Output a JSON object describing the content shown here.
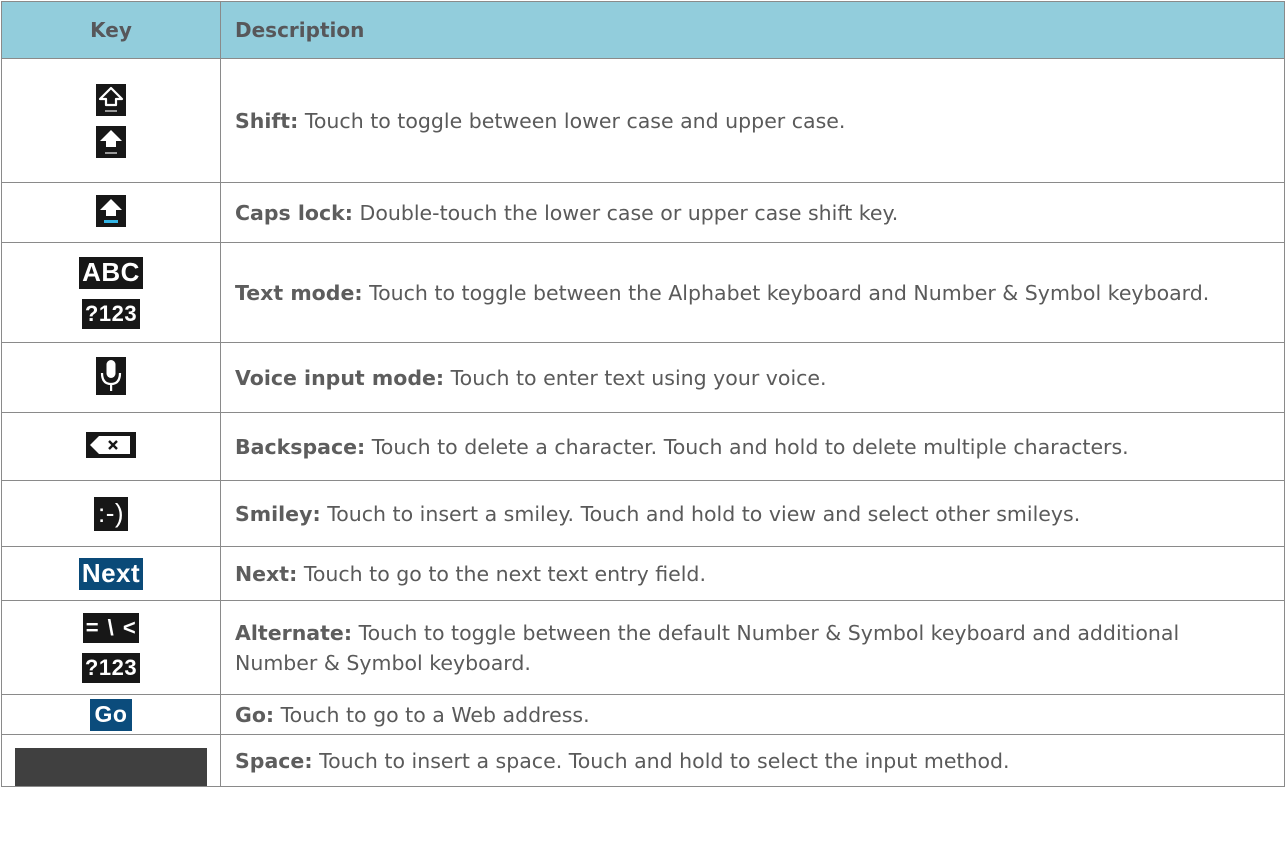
{
  "header": {
    "key": "Key",
    "description": "Description"
  },
  "rows": [
    {
      "name": "Shift:",
      "text": "Touch to toggle between lower case and upper case."
    },
    {
      "name": "Caps lock:",
      "text": "Double-touch the lower case or upper case shift key."
    },
    {
      "name": "Text mode:",
      "text": "Touch to toggle between the Alphabet keyboard and Number & Symbol keyboard."
    },
    {
      "name": "Voice input mode:",
      "text": "Touch to enter text using your voice."
    },
    {
      "name": "Backspace:",
      "text": "Touch to delete a character. Touch and hold to delete multiple characters."
    },
    {
      "name": "Smiley:",
      "text": "Touch to insert a smiley. Touch and hold to view and select other smileys."
    },
    {
      "name": "Next:",
      "text": "Touch to go to the next text entry field."
    },
    {
      "name": "Alternate:",
      "text": "Touch to toggle between the default Number & Symbol keyboard and additional Number & Symbol keyboard."
    },
    {
      "name": "Go:",
      "text": "Touch to go to a Web address."
    },
    {
      "name": "Space:",
      "text": "Touch to insert a space. Touch and hold to select the input method."
    }
  ],
  "key_labels": {
    "abc": "ABC",
    "num": "?123",
    "smiley": ":-)",
    "next": "Next",
    "alt": "= \\ <",
    "num2": "?123",
    "go": "Go"
  },
  "icons": {
    "shift_lower": "shift-outline-icon",
    "shift_upper": "shift-filled-icon",
    "caps_lock": "caps-lock-icon",
    "mic": "microphone-icon",
    "backspace": "backspace-icon",
    "space": "space-bar-icon"
  },
  "colors": {
    "header_bg": "#92cddc",
    "caps_indicator": "#33b5e5",
    "next_bg": "#0a4a78"
  }
}
